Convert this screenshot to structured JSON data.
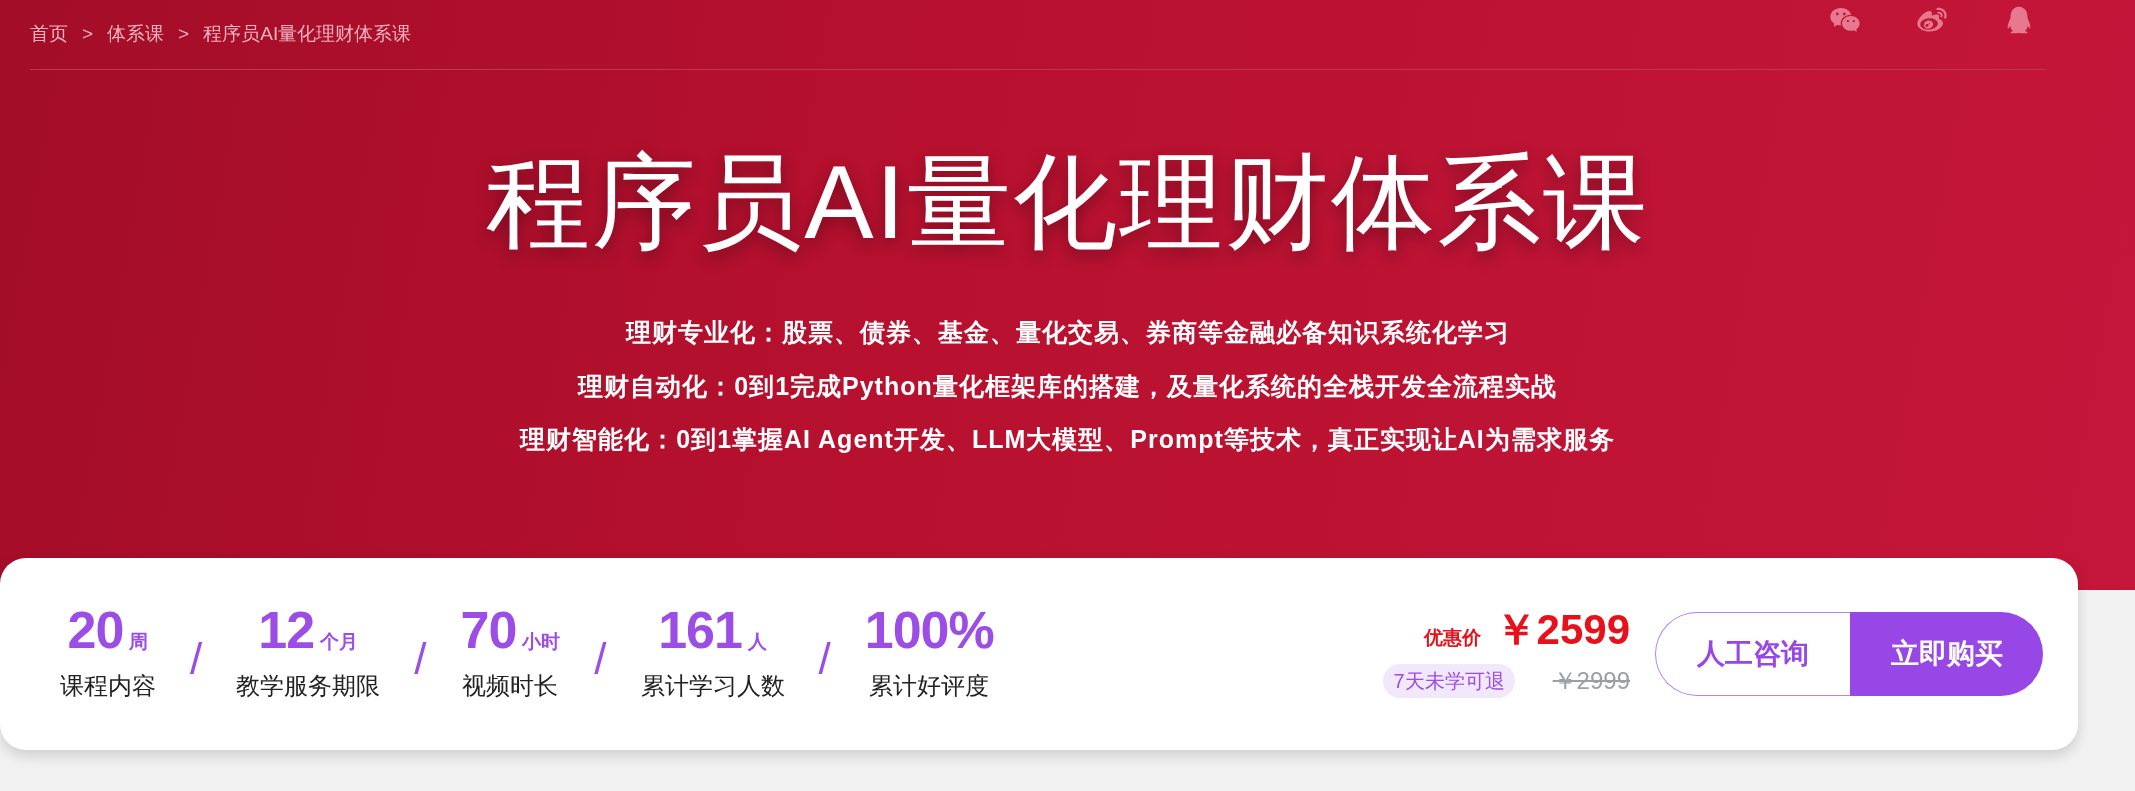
{
  "breadcrumb": [
    {
      "label": "首页"
    },
    {
      "label": "体系课"
    },
    {
      "label": "程序员AI量化理财体系课"
    }
  ],
  "breadcrumb_separator": ">",
  "title": "程序员AI量化理财体系课",
  "features": [
    "理财专业化：股票、债券、基金、量化交易、券商等金融必备知识系统化学习",
    "理财自动化：0到1完成Python量化框架库的搭建，及量化系统的全栈开发全流程实战",
    "理财智能化：0到1掌握AI Agent开发、LLM大模型、Prompt等技术，真正实现让AI为需求服务"
  ],
  "stats": [
    {
      "value": "20",
      "unit": "周",
      "label": "课程内容"
    },
    {
      "value": "12",
      "unit": "个月",
      "label": "教学服务期限"
    },
    {
      "value": "70",
      "unit": "小时",
      "label": "视频时长"
    },
    {
      "value": "161",
      "unit": "人",
      "label": "累计学习人数"
    },
    {
      "value": "100%",
      "label": "累计好评度"
    }
  ],
  "stat_separator": "/",
  "price": {
    "label": "优惠价",
    "current": "￥2599",
    "original": "￥2999",
    "badge": "7天未学可退"
  },
  "buttons": [
    {
      "label": "人工咨询",
      "kind": "outline"
    },
    {
      "label": "立即购买",
      "kind": "solid"
    }
  ]
}
